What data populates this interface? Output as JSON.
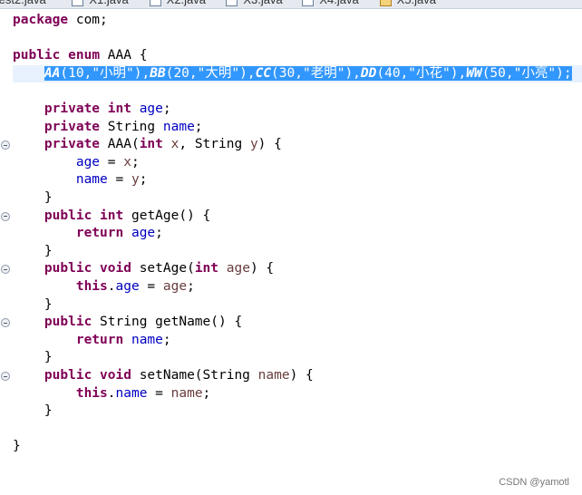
{
  "tabs": [
    {
      "label": "est2.java",
      "icon": "java-file-icon"
    },
    {
      "label": "X1.java",
      "icon": "java-file-icon"
    },
    {
      "label": "X2.java",
      "icon": "java-file-icon"
    },
    {
      "label": "X3.java",
      "icon": "java-file-icon"
    },
    {
      "label": "X4.java",
      "icon": "java-file-icon"
    },
    {
      "label": "X5.java",
      "icon": "java-file-warning-icon"
    }
  ],
  "code": [
    [
      [
        "package",
        "kw"
      ],
      [
        " com;",
        ""
      ]
    ],
    [],
    [
      [
        "public",
        "kw"
      ],
      [
        " ",
        ""
      ],
      [
        "enum",
        "kw"
      ],
      [
        " AAA {",
        ""
      ]
    ],
    [
      [
        "    ",
        ""
      ],
      [
        "AA",
        "ec"
      ],
      [
        "(10,",
        ""
      ],
      [
        "\"小明\"",
        "st"
      ],
      [
        "),",
        ""
      ],
      [
        "BB",
        "ec"
      ],
      [
        "(20,",
        ""
      ],
      [
        "\"大明\"",
        "st"
      ],
      [
        "),",
        ""
      ],
      [
        "CC",
        "ec"
      ],
      [
        "(30,",
        ""
      ],
      [
        "\"老明\"",
        "st"
      ],
      [
        "),",
        ""
      ],
      [
        "DD",
        "ec"
      ],
      [
        "(40,",
        ""
      ],
      [
        "\"小花\"",
        "st"
      ],
      [
        "),",
        ""
      ],
      [
        "WW",
        "ec"
      ],
      [
        "(50,",
        ""
      ],
      [
        "\"小亮\"",
        "st"
      ],
      [
        ");",
        ""
      ]
    ],
    [],
    [
      [
        "    ",
        ""
      ],
      [
        "private",
        "kw"
      ],
      [
        " ",
        ""
      ],
      [
        "int",
        "kw"
      ],
      [
        " ",
        ""
      ],
      [
        "age",
        "fd"
      ],
      [
        ";",
        ""
      ]
    ],
    [
      [
        "    ",
        ""
      ],
      [
        "private",
        "kw"
      ],
      [
        " String ",
        ""
      ],
      [
        "name",
        "fd"
      ],
      [
        ";",
        ""
      ]
    ],
    [
      [
        "    ",
        ""
      ],
      [
        "private",
        "kw"
      ],
      [
        " AAA(",
        ""
      ],
      [
        "int",
        "kw"
      ],
      [
        " ",
        ""
      ],
      [
        "x",
        "pm"
      ],
      [
        ", String ",
        ""
      ],
      [
        "y",
        "pm"
      ],
      [
        ") {",
        ""
      ]
    ],
    [
      [
        "        ",
        ""
      ],
      [
        "age",
        "fd"
      ],
      [
        " = ",
        ""
      ],
      [
        "x",
        "pm"
      ],
      [
        ";",
        ""
      ]
    ],
    [
      [
        "        ",
        ""
      ],
      [
        "name",
        "fd"
      ],
      [
        " = ",
        ""
      ],
      [
        "y",
        "pm"
      ],
      [
        ";",
        ""
      ]
    ],
    [
      [
        "    }",
        ""
      ]
    ],
    [
      [
        "    ",
        ""
      ],
      [
        "public",
        "kw"
      ],
      [
        " ",
        ""
      ],
      [
        "int",
        "kw"
      ],
      [
        " getAge() {",
        ""
      ]
    ],
    [
      [
        "        ",
        ""
      ],
      [
        "return",
        "kw"
      ],
      [
        " ",
        ""
      ],
      [
        "age",
        "fd"
      ],
      [
        ";",
        ""
      ]
    ],
    [
      [
        "    }",
        ""
      ]
    ],
    [
      [
        "    ",
        ""
      ],
      [
        "public",
        "kw"
      ],
      [
        " ",
        ""
      ],
      [
        "void",
        "kw"
      ],
      [
        " setAge(",
        ""
      ],
      [
        "int",
        "kw"
      ],
      [
        " ",
        ""
      ],
      [
        "age",
        "pm"
      ],
      [
        ") {",
        ""
      ]
    ],
    [
      [
        "        ",
        ""
      ],
      [
        "this",
        "kw"
      ],
      [
        ".",
        ""
      ],
      [
        "age",
        "fd"
      ],
      [
        " = ",
        ""
      ],
      [
        "age",
        "pm"
      ],
      [
        ";",
        ""
      ]
    ],
    [
      [
        "    }",
        ""
      ]
    ],
    [
      [
        "    ",
        ""
      ],
      [
        "public",
        "kw"
      ],
      [
        " String getName() {",
        ""
      ]
    ],
    [
      [
        "        ",
        ""
      ],
      [
        "return",
        "kw"
      ],
      [
        " ",
        ""
      ],
      [
        "name",
        "fd"
      ],
      [
        ";",
        ""
      ]
    ],
    [
      [
        "    }",
        ""
      ]
    ],
    [
      [
        "    ",
        ""
      ],
      [
        "public",
        "kw"
      ],
      [
        " ",
        ""
      ],
      [
        "void",
        "kw"
      ],
      [
        " setName(String ",
        ""
      ],
      [
        "name",
        "pm"
      ],
      [
        ") {",
        ""
      ]
    ],
    [
      [
        "        ",
        ""
      ],
      [
        "this",
        "kw"
      ],
      [
        ".",
        ""
      ],
      [
        "name",
        "fd"
      ],
      [
        " = ",
        ""
      ],
      [
        "name",
        "pm"
      ],
      [
        ";",
        ""
      ]
    ],
    [
      [
        "    }",
        ""
      ]
    ],
    [],
    [
      [
        "}",
        ""
      ]
    ]
  ],
  "selected_line": 3,
  "fold_lines": [
    7,
    11,
    14,
    17,
    20
  ],
  "watermark": "CSDN @yamotl"
}
